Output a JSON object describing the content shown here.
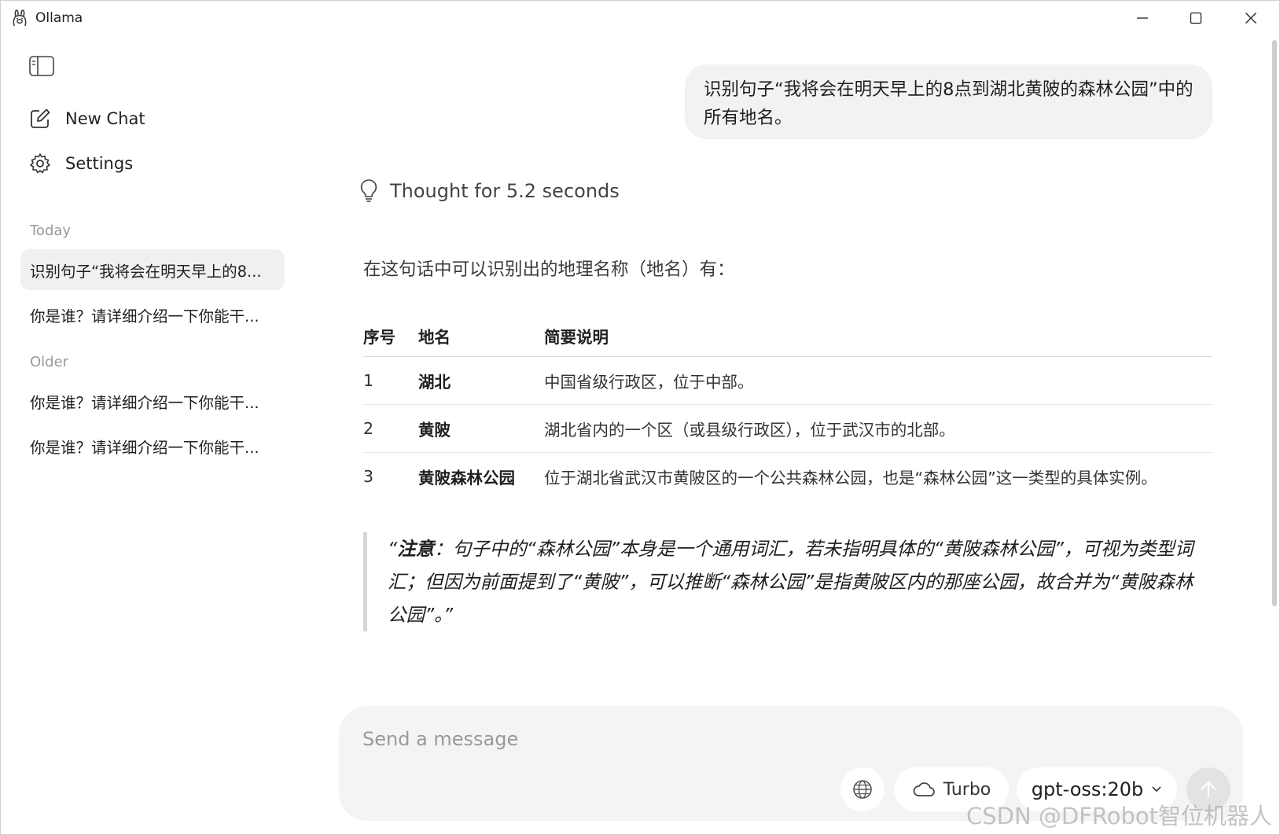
{
  "window": {
    "title": "Ollama"
  },
  "sidebar": {
    "new_chat_label": "New Chat",
    "settings_label": "Settings",
    "sections": {
      "today": "Today",
      "older": "Older"
    },
    "chats": [
      {
        "title": "识别句子“我将会在明天早上的8...",
        "active": true
      },
      {
        "title": "你是谁？请详细介绍一下你能干...",
        "active": false
      },
      {
        "title": "你是谁？请详细介绍一下你能干...",
        "active": false
      },
      {
        "title": "你是谁？请详细介绍一下你能干...",
        "active": false
      }
    ]
  },
  "conversation": {
    "user_message": "识别句子“我将会在明天早上的8点到湖北黄陂的森林公园”中的所有地名。",
    "thought_label": "Thought for 5.2 seconds",
    "intro": "在这句话中可以识别出的地理名称（地名）有：",
    "table": {
      "headers": [
        "序号",
        "地名",
        "简要说明"
      ],
      "rows": [
        {
          "n": "1",
          "place": "湖北",
          "desc": "中国省级行政区，位于中部。"
        },
        {
          "n": "2",
          "place": "黄陂",
          "desc": "湖北省内的一个区（或县级行政区），位于武汉市的北部。"
        },
        {
          "n": "3",
          "place": "黄陂森林公园",
          "desc": "位于湖北省武汉市黄陂区的一个公共森林公园，也是“森林公园”这一类型的具体实例。"
        }
      ]
    },
    "note": {
      "open_quote": "“",
      "label": "注意",
      "text": "：句子中的“森林公园”本身是一个通用词汇，若未指明具体的“黄陂森林公园”，可视为类型词汇；但因为前面提到了“黄陂”，可以推断“森林公园”是指黄陂区内的那座公园，故合并为“黄陂森林公园”。”"
    }
  },
  "composer": {
    "placeholder": "Send a message",
    "turbo_label": "Turbo",
    "model_label": "gpt-oss:20b"
  },
  "watermark": "CSDN @DFRobot智位机器人"
}
